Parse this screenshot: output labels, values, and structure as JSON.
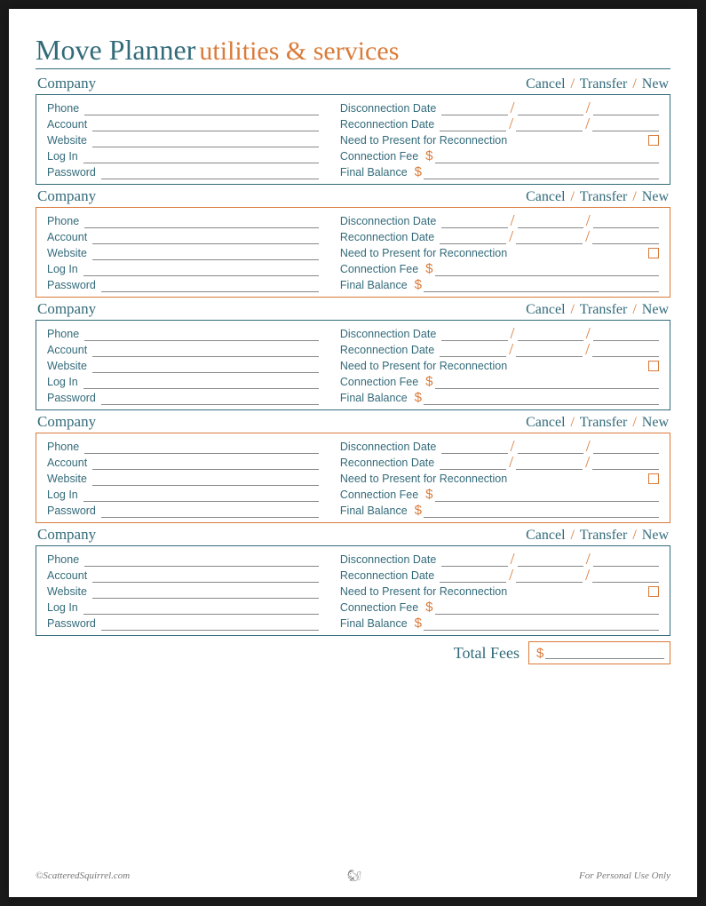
{
  "title": {
    "main": "Move Planner",
    "sub": "utilities & services"
  },
  "section": {
    "company": "Company",
    "actions": [
      "Cancel",
      "Transfer",
      "New"
    ],
    "left_fields": [
      "Phone",
      "Account",
      "Website",
      "Log In",
      "Password"
    ],
    "right": {
      "disconnect": "Disconnection Date",
      "reconnect": "Reconnection Date",
      "present": "Need to Present for Reconnection",
      "fee": "Connection Fee",
      "balance": "Final Balance"
    }
  },
  "boxes": [
    "teal",
    "orange",
    "teal",
    "orange",
    "teal"
  ],
  "total_label": "Total Fees",
  "footer": {
    "left": "©ScatteredSquirrel.com",
    "right": "For Personal Use Only"
  },
  "symbols": {
    "slash": "/",
    "dollar": "$"
  }
}
